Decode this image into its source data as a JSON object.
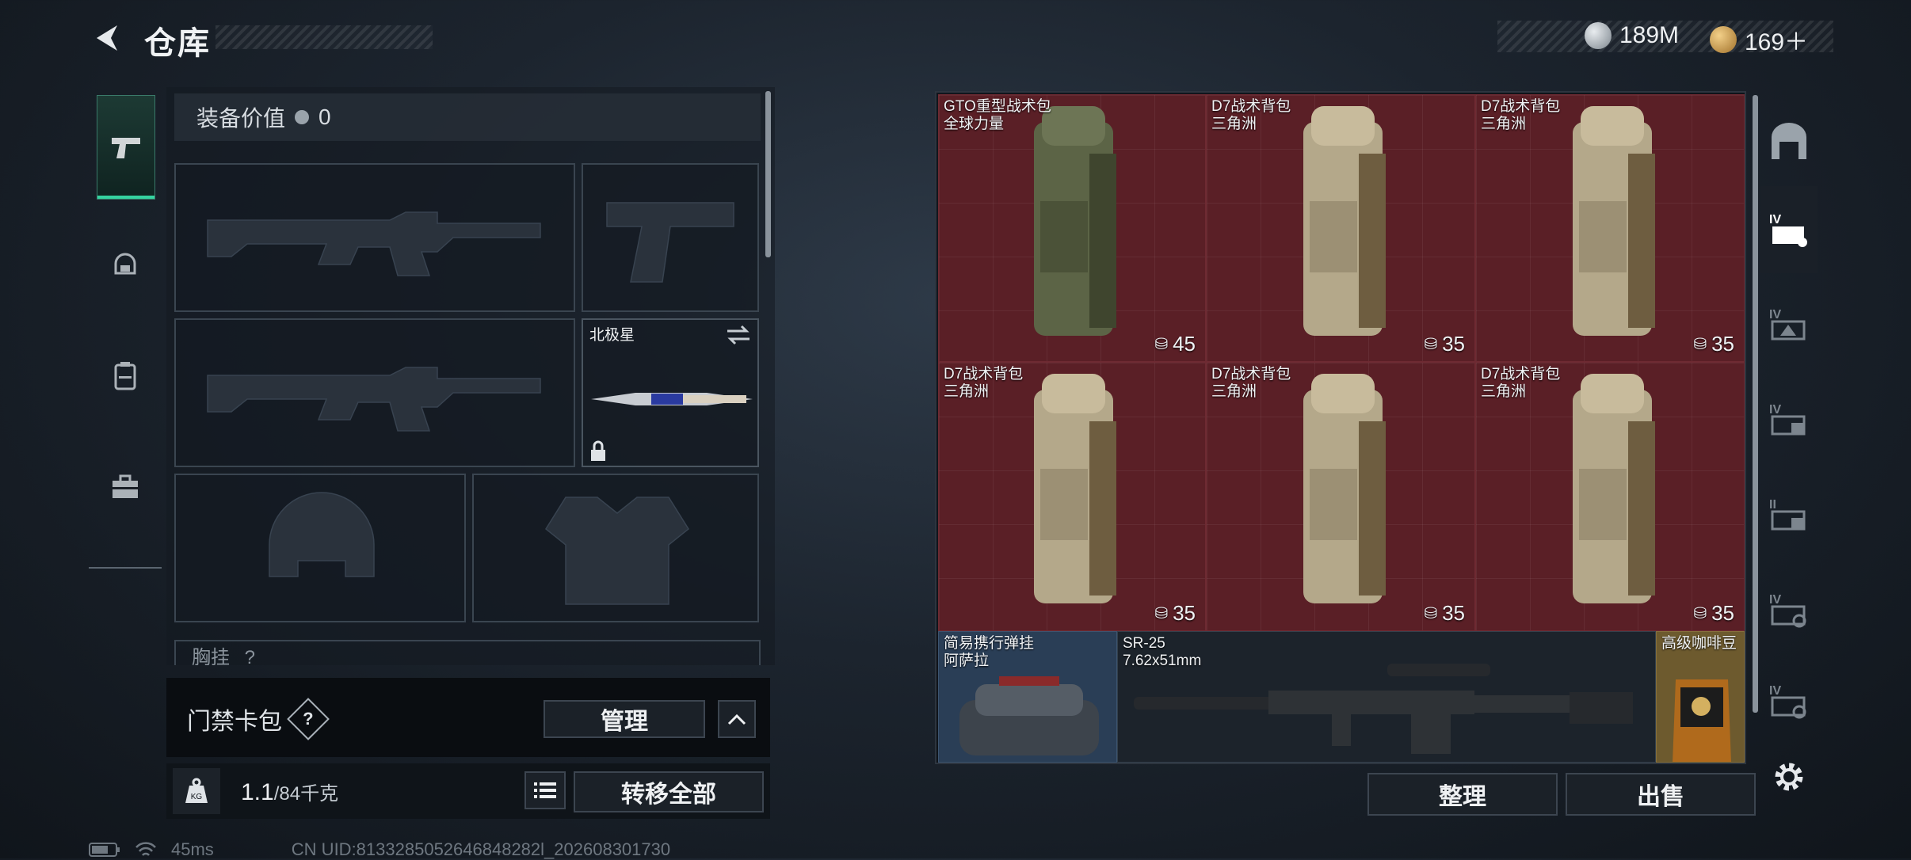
{
  "header": {
    "title": "仓库"
  },
  "currency": {
    "coin_a": "189M",
    "coin_b": "169＋"
  },
  "equipment": {
    "value_label": "装备价值",
    "value": "0",
    "melee_name": "北极星",
    "chest_label": "胸挂",
    "chest_badge": "?"
  },
  "card_pack": {
    "label": "门禁卡包",
    "help": "?",
    "manage_button": "管理"
  },
  "weight": {
    "current": "1.1",
    "max_unit": "/84千克",
    "transfer_all": "转移全部"
  },
  "storage": {
    "items": [
      {
        "name": "GTO重型战术包",
        "sub": "全球力量",
        "cap": "45"
      },
      {
        "name": "D7战术背包",
        "sub": "三角洲",
        "cap": "35"
      },
      {
        "name": "D7战术背包",
        "sub": "三角洲",
        "cap": "35"
      },
      {
        "name": "D7战术背包",
        "sub": "三角洲",
        "cap": "35"
      },
      {
        "name": "D7战术背包",
        "sub": "三角洲",
        "cap": "35"
      },
      {
        "name": "D7战术背包",
        "sub": "三角洲",
        "cap": "35"
      }
    ],
    "rig": {
      "name": "简易携行弹挂",
      "sub": "阿萨拉"
    },
    "rifle": {
      "name": "SR-25",
      "sub": "7.62x51mm"
    },
    "coffee": {
      "name": "高级咖啡豆"
    },
    "sort_button": "整理",
    "sell_button": "出售"
  },
  "status": {
    "ping": "45ms",
    "uid": "CN UID:8133285052646848282l_202608301730"
  },
  "colors": {
    "item_bg": "#5a1f26",
    "accent": "#35d3a0"
  },
  "icons": [
    "back-arrow-icon",
    "silver-coin-icon",
    "gold-coin-icon",
    "pistol-icon",
    "helmet-icon",
    "backpack-icon",
    "toolbox-icon",
    "lock-icon",
    "swap-icon",
    "weight-icon",
    "list-icon",
    "chevron-up-icon",
    "settings-icon"
  ]
}
